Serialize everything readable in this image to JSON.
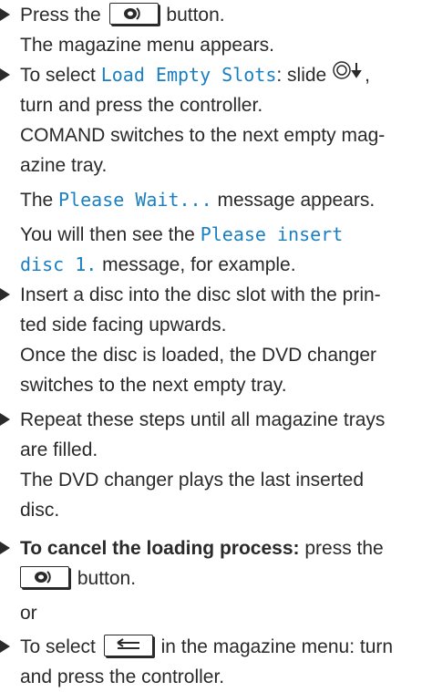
{
  "s1": {
    "pre": "Press the",
    "post": "button.",
    "result": "The magazine menu appears."
  },
  "s2": {
    "pre": "To select",
    "hl": "Load Empty Slots",
    "mid": ": slide",
    "post": ",",
    "line2": "turn and press the controller.",
    "r1": "COMAND switches to the next empty mag-",
    "r2": "azine tray.",
    "r3_pre": "The",
    "r3_hl": "Please Wait...",
    "r3_post": "message appears.",
    "r4_pre": "You will then see the",
    "r4_hl": "Please insert",
    "r5_hl": "disc 1.",
    "r5_post": "message, for example."
  },
  "s3": {
    "l1": "Insert a disc into the disc slot with the prin-",
    "l2": "ted side facing upwards.",
    "r1": "Once the disc is loaded, the DVD changer",
    "r2": "switches to the next empty tray."
  },
  "s4": {
    "l1": "Repeat these steps until all magazine trays",
    "l2": "are filled.",
    "r1": "The DVD changer plays the last inserted",
    "r2": "disc."
  },
  "s5": {
    "bold": "To cancel the loading process:",
    "post": "press the",
    "l2_post": "button."
  },
  "or": "or",
  "s6": {
    "pre": "To select",
    "post": "in the magazine menu: turn",
    "l2": "and press the controller."
  },
  "icons": {
    "disc_button": "disc-eject-button-icon",
    "back_button": "back-arrow-button-icon",
    "controller": "controller-slide-down-icon"
  },
  "colors": {
    "highlight": "#1a7fc1",
    "text": "#2a2a2a"
  }
}
